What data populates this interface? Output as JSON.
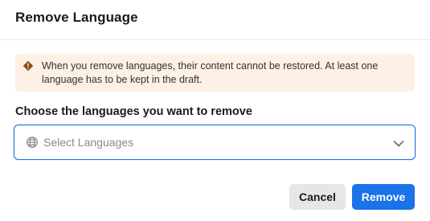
{
  "dialog": {
    "title": "Remove Language",
    "warning": {
      "icon": "warning-diamond-icon",
      "text": "When you remove languages, their content cannot be restored. At least one language has to be kept in the draft."
    },
    "field": {
      "label": "Choose the languages you want to remove",
      "placeholder": "Select Languages",
      "icon": "globe-icon",
      "dropdown_icon": "chevron-down-icon"
    },
    "buttons": {
      "cancel_label": "Cancel",
      "remove_label": "Remove"
    },
    "colors": {
      "accent": "#1a73e8",
      "warning_bg": "#fdf0e4",
      "warning_icon": "#8a4a10"
    }
  }
}
